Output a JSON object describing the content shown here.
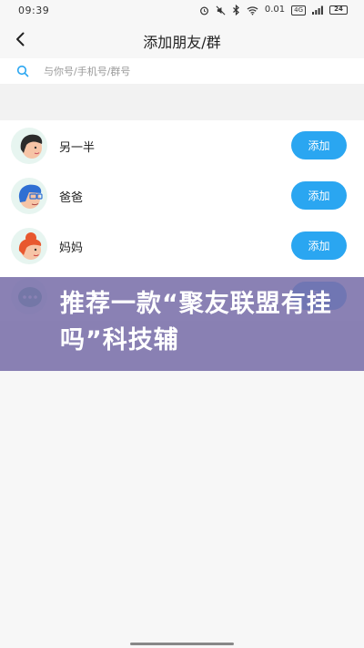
{
  "status_bar": {
    "time": "09:39",
    "icons": [
      "alarm-icon",
      "mute-icon",
      "bluetooth-icon",
      "wifi-icon"
    ],
    "network_speed": "0.01",
    "network_type": "4G",
    "battery": "24"
  },
  "header": {
    "title": "添加朋友/群"
  },
  "search": {
    "placeholder": "与你号/手机号/群号"
  },
  "contacts": [
    {
      "name": "另一半",
      "button": "添加"
    },
    {
      "name": "爸爸",
      "button": "添加"
    },
    {
      "name": "妈妈",
      "button": "添加"
    },
    {
      "name": "",
      "button": "添加"
    }
  ],
  "overlay": {
    "text": "推荐一款“聚友联盟有挂吗”科技辅"
  },
  "colors": {
    "accent": "#2aa6f1",
    "overlay": "#7a70aa"
  }
}
